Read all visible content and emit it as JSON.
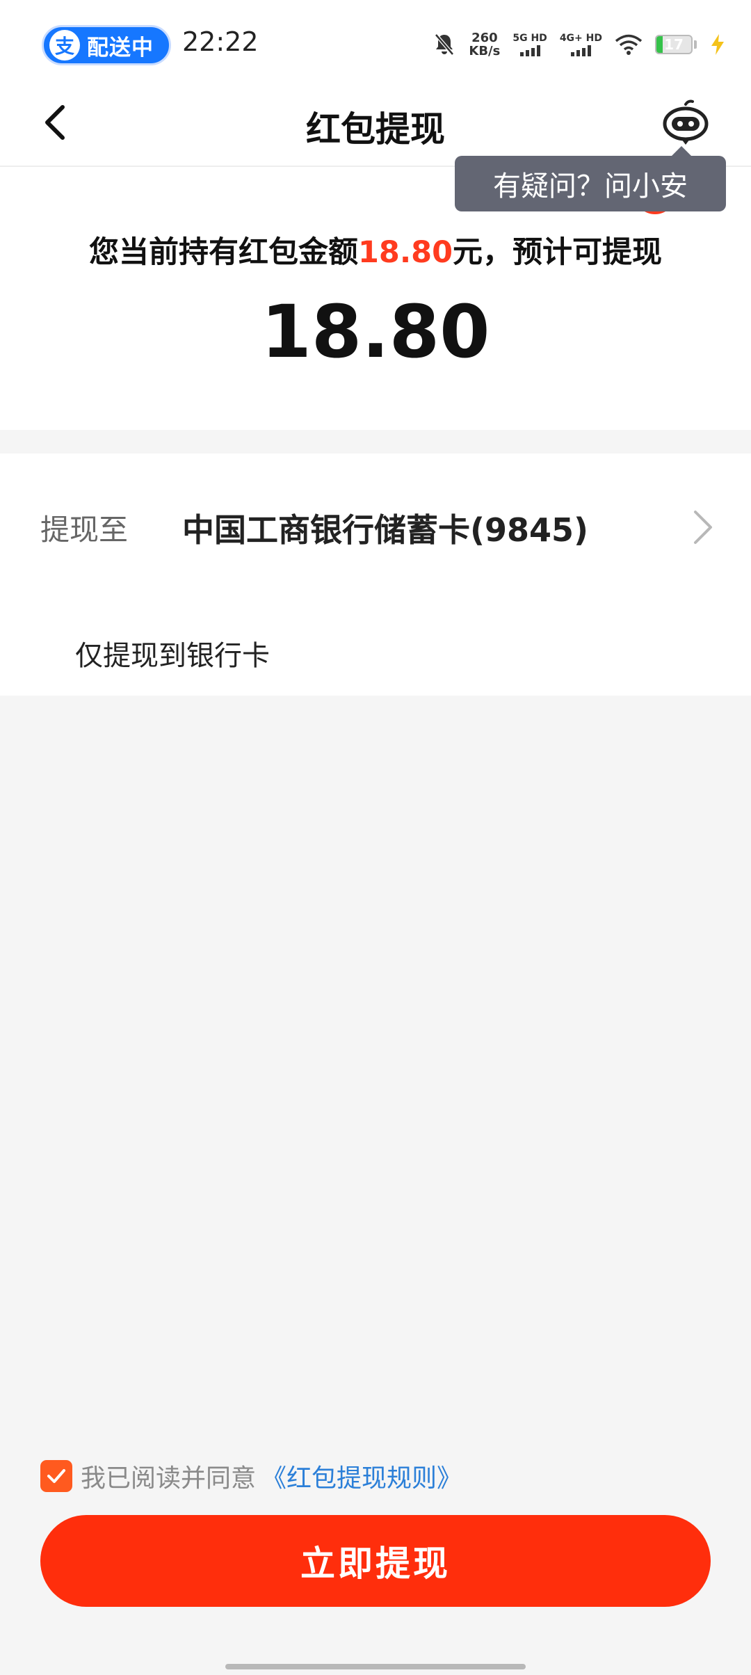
{
  "status_bar": {
    "pill_logo": "支",
    "pill_text": "配送中",
    "time": "22:22",
    "speed_value": "260",
    "speed_unit": "KB/s",
    "sim1_label": "5G HD",
    "sim2_label": "4G+ HD",
    "battery_level": "17",
    "battery_fraction": 0.17
  },
  "nav": {
    "title": "红包提现"
  },
  "tooltip": {
    "text": "有疑问？问小安"
  },
  "summary": {
    "prefix": "您当前持有红包金额",
    "amount": "18.80",
    "suffix": "元，预计可提现"
  },
  "withdraw_amount": "18.80",
  "withdraw_to": {
    "label": "提现至",
    "value": "中国工商银行储蓄卡(9845)"
  },
  "option": {
    "label": "仅提现到银行卡",
    "selected": true
  },
  "agreement": {
    "checked": true,
    "text": "我已阅读并同意",
    "link": "《红包提现规则》"
  },
  "button": {
    "label": "立即提现"
  },
  "colors": {
    "accent": "#ff2e0c",
    "link": "#2b7fd8",
    "tooltip_bg": "#636673",
    "brand_blue": "#1677ff"
  }
}
